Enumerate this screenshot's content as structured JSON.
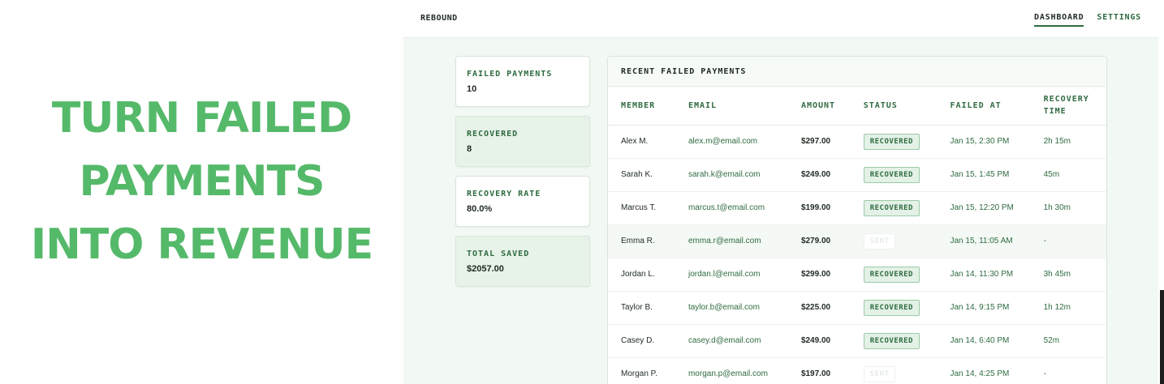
{
  "hero": {
    "lines": [
      "TURN FAILED",
      "PAYMENTS",
      "INTO REVENUE"
    ],
    "color": "#55b96a"
  },
  "app": {
    "brand": "REBOUND",
    "nav": [
      {
        "label": "DASHBOARD",
        "active": true
      },
      {
        "label": "SETTINGS",
        "active": false
      }
    ]
  },
  "stats": [
    {
      "label": "FAILED PAYMENTS",
      "value": "10"
    },
    {
      "label": "RECOVERED",
      "value": "8"
    },
    {
      "label": "RECOVERY RATE",
      "value": "80.0%"
    },
    {
      "label": "TOTAL SAVED",
      "value": "$2057.00"
    }
  ],
  "table": {
    "title": "RECENT FAILED PAYMENTS",
    "headers": [
      "MEMBER",
      "EMAIL",
      "AMOUNT",
      "STATUS",
      "FAILED AT",
      "RECOVERY TIME"
    ],
    "rows": [
      {
        "member": "Alex M.",
        "email": "alex.m@email.com",
        "amount": "$297.00",
        "status": "RECOVERED",
        "failed_at": "Jan 15, 2:30 PM",
        "recovery_time": "2h 15m"
      },
      {
        "member": "Sarah K.",
        "email": "sarah.k@email.com",
        "amount": "$249.00",
        "status": "RECOVERED",
        "failed_at": "Jan 15, 1:45 PM",
        "recovery_time": "45m"
      },
      {
        "member": "Marcus T.",
        "email": "marcus.t@email.com",
        "amount": "$199.00",
        "status": "RECOVERED",
        "failed_at": "Jan 15, 12:20 PM",
        "recovery_time": "1h 30m"
      },
      {
        "member": "Emma R.",
        "email": "emma.r@email.com",
        "amount": "$279.00",
        "status": "SENT",
        "failed_at": "Jan 15, 11:05 AM",
        "recovery_time": "-"
      },
      {
        "member": "Jordan L.",
        "email": "jordan.l@email.com",
        "amount": "$299.00",
        "status": "RECOVERED",
        "failed_at": "Jan 14, 11:30 PM",
        "recovery_time": "3h 45m"
      },
      {
        "member": "Taylor B.",
        "email": "taylor.b@email.com",
        "amount": "$225.00",
        "status": "RECOVERED",
        "failed_at": "Jan 14, 9:15 PM",
        "recovery_time": "1h 12m"
      },
      {
        "member": "Casey D.",
        "email": "casey.d@email.com",
        "amount": "$249.00",
        "status": "RECOVERED",
        "failed_at": "Jan 14, 6:40 PM",
        "recovery_time": "52m"
      },
      {
        "member": "Morgan P.",
        "email": "morgan.p@email.com",
        "amount": "$197.00",
        "status": "SENT",
        "failed_at": "Jan 14, 4:25 PM",
        "recovery_time": "-"
      }
    ]
  }
}
